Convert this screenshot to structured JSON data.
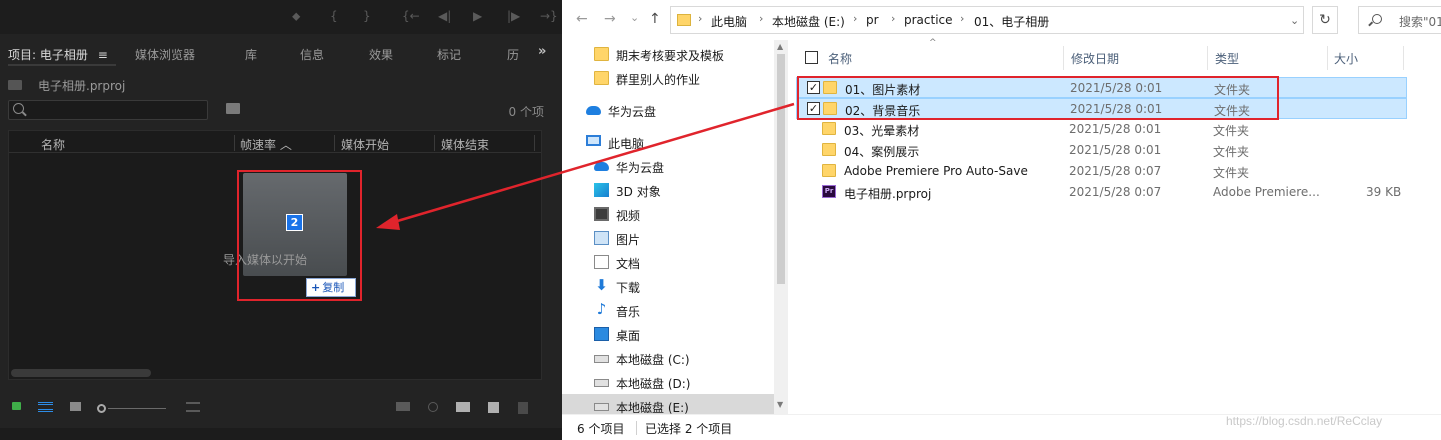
{
  "premiere": {
    "tabs": [
      {
        "label": "项目: 电子相册",
        "menu": "≡"
      },
      {
        "label": "媒体浏览器"
      },
      {
        "label": "库"
      },
      {
        "label": "信息"
      },
      {
        "label": "效果"
      },
      {
        "label": "标记"
      },
      {
        "label": "历"
      }
    ],
    "tab_more": "»",
    "project_file": "电子相册.prproj",
    "search_placeholder": "",
    "item_count": "0 个项",
    "columns": [
      "名称",
      "帧速率",
      "媒体开始",
      "媒体结束"
    ],
    "sort_indicator": "︿",
    "drag_badge": "2",
    "import_hint": "导入媒体以开始",
    "copy_tip": {
      "plus": "+",
      "label": "复制"
    },
    "transport": [
      "⬥",
      "{",
      "}",
      "{←",
      "◀|",
      "▶",
      "|▶",
      "→}"
    ]
  },
  "explorer": {
    "nav_buttons": {
      "back": "←",
      "forward": "→",
      "recent": "⌄",
      "up": "↑"
    },
    "breadcrumbs": [
      "此电脑",
      "本地磁盘 (E:)",
      "pr",
      "practice",
      "01、电子相册"
    ],
    "crumb_sep": "›",
    "address_dropdown": "⌄",
    "refresh": "↻",
    "search_placeholder": "搜索\"01",
    "sidebar": [
      {
        "label": "期末考核要求及模板",
        "icon": "folder-icon"
      },
      {
        "label": "群里别人的作业",
        "icon": "folder-icon"
      },
      {
        "label": "华为云盘",
        "icon": "cloud-icon"
      },
      {
        "label": "此电脑",
        "icon": "computer-icon"
      },
      {
        "label": "华为云盘",
        "icon": "cloud-icon"
      },
      {
        "label": "3D 对象",
        "icon": "3d-objects-icon"
      },
      {
        "label": "视频",
        "icon": "video-icon"
      },
      {
        "label": "图片",
        "icon": "pictures-icon"
      },
      {
        "label": "文档",
        "icon": "documents-icon"
      },
      {
        "label": "下载",
        "icon": "downloads-icon",
        "glyph": "⬇"
      },
      {
        "label": "音乐",
        "icon": "music-icon",
        "glyph": "♪"
      },
      {
        "label": "桌面",
        "icon": "desktop-icon"
      },
      {
        "label": "本地磁盘 (C:)",
        "icon": "drive-icon"
      },
      {
        "label": "本地磁盘 (D:)",
        "icon": "drive-icon"
      },
      {
        "label": "本地磁盘 (E:)",
        "icon": "drive-icon"
      }
    ],
    "columns": {
      "name": "名称",
      "date": "修改日期",
      "type": "类型",
      "size": "大小"
    },
    "sort_arrow": "^",
    "files": [
      {
        "name": "01、图片素材",
        "date": "2021/5/28 0:01",
        "type": "文件夹",
        "size": "",
        "kind": "folder",
        "selected": true,
        "check": "✓"
      },
      {
        "name": "02、背景音乐",
        "date": "2021/5/28 0:01",
        "type": "文件夹",
        "size": "",
        "kind": "folder",
        "selected": true,
        "check": "✓"
      },
      {
        "name": "03、光晕素材",
        "date": "2021/5/28 0:01",
        "type": "文件夹",
        "size": "",
        "kind": "folder",
        "selected": false
      },
      {
        "name": "04、案例展示",
        "date": "2021/5/28 0:01",
        "type": "文件夹",
        "size": "",
        "kind": "folder",
        "selected": false
      },
      {
        "name": "Adobe Premiere Pro Auto-Save",
        "date": "2021/5/28 0:07",
        "type": "文件夹",
        "size": "",
        "kind": "folder",
        "selected": false
      },
      {
        "name": "电子相册.prproj",
        "date": "2021/5/28 0:07",
        "type": "Adobe Premiere...",
        "size": "39 KB",
        "kind": "premiere",
        "selected": false,
        "icon_text": "Pr"
      }
    ],
    "status": {
      "count": "6 个项目",
      "selected": "已选择 2 个项目"
    },
    "scroll": {
      "up": "▲",
      "down": "▼"
    }
  },
  "watermark": "https://blog.csdn.net/ReCclay",
  "colors": {
    "annotation_red": "#e0242c",
    "selection_blue": "#cce8ff",
    "premiere_bg": "#232323"
  }
}
